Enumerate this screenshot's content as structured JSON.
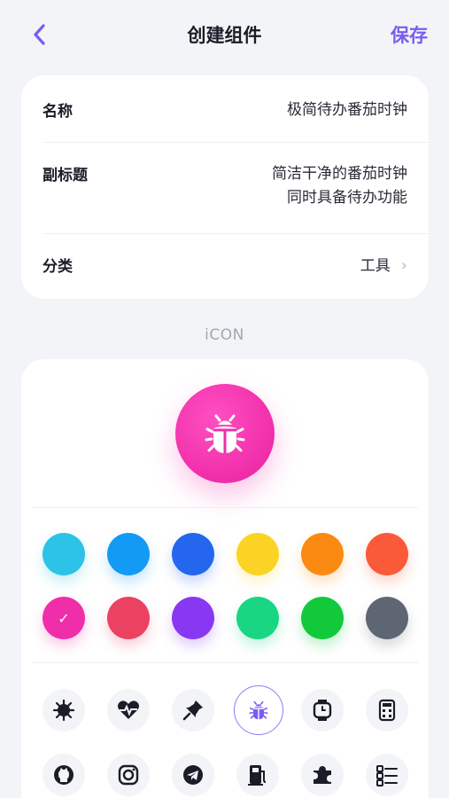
{
  "nav": {
    "title": "创建组件",
    "save_label": "保存"
  },
  "form": {
    "name_label": "名称",
    "name_value": "极简待办番茄时钟",
    "subtitle_label": "副标题",
    "subtitle_line1": "简洁干净的番茄时钟",
    "subtitle_line2": "同时具备待办功能",
    "category_label": "分类",
    "category_value": "工具"
  },
  "icon_section": {
    "label": "iCON",
    "selected_icon": "bug-icon",
    "selected_color": "#f02ea9"
  },
  "colors": [
    {
      "name": "cyan",
      "hex": "#2cc3e6",
      "selected": false
    },
    {
      "name": "sky-blue",
      "hex": "#129af5",
      "selected": false
    },
    {
      "name": "blue",
      "hex": "#2467ee",
      "selected": false
    },
    {
      "name": "yellow",
      "hex": "#fbd324",
      "selected": false
    },
    {
      "name": "orange",
      "hex": "#fb8a12",
      "selected": false
    },
    {
      "name": "red-orange",
      "hex": "#fb5a38",
      "selected": false
    },
    {
      "name": "magenta",
      "hex": "#f02ea9",
      "selected": true
    },
    {
      "name": "rose",
      "hex": "#ea4260",
      "selected": false
    },
    {
      "name": "purple",
      "hex": "#8838f2",
      "selected": false
    },
    {
      "name": "mint",
      "hex": "#18d682",
      "selected": false
    },
    {
      "name": "green",
      "hex": "#12c93a",
      "selected": false
    },
    {
      "name": "gray",
      "hex": "#5f6673",
      "selected": false
    }
  ],
  "icons": [
    "virus-icon",
    "heart-pulse-icon",
    "pin-icon",
    "bug-icon",
    "watch-icon",
    "calculator-icon",
    "github-icon",
    "instagram-icon",
    "telegram-icon",
    "ev-charger-icon",
    "puzzle-icon",
    "checklist-icon"
  ]
}
